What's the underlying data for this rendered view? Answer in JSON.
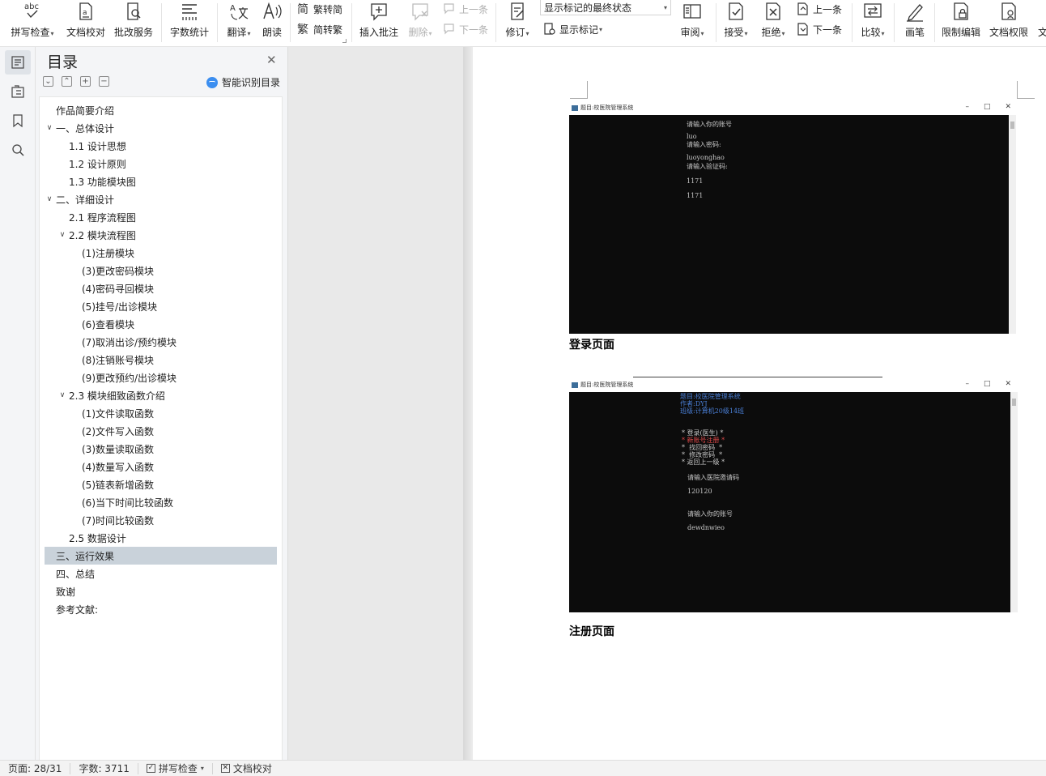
{
  "ribbon": {
    "spell_check": "拼写检查",
    "doc_proof": "文档校对",
    "revision_service": "批改服务",
    "word_count": "字数统计",
    "translate": "翻译",
    "read_aloud": "朗读",
    "trad_to_simp": "繁转简",
    "simp_to_trad": "简转繁",
    "insert_comment": "插入批注",
    "delete": "删除",
    "prev_comment": "上一条",
    "next_comment": "下一条",
    "track_changes": "修订",
    "markup_select": "显示标记的最终状态",
    "show_markup": "显示标记",
    "review": "审阅",
    "accept": "接受",
    "reject": "拒绝",
    "prev_change": "上一条",
    "next_change": "下一条",
    "compare": "比较",
    "pen": "画笔",
    "restrict_edit": "限制编辑",
    "doc_permission": "文档权限",
    "cut_label": "文"
  },
  "toc": {
    "title": "目录",
    "smart_toc": "智能识别目录",
    "items": [
      {
        "label": "作品简要介绍",
        "level": 1,
        "twisty": ""
      },
      {
        "label": "一、总体设计",
        "level": 1,
        "twisty": "∨"
      },
      {
        "label": "1.1 设计思想",
        "level": 2,
        "twisty": ""
      },
      {
        "label": "1.2 设计原则",
        "level": 2,
        "twisty": ""
      },
      {
        "label": "1.3 功能模块图",
        "level": 2,
        "twisty": ""
      },
      {
        "label": "二、详细设计",
        "level": 1,
        "twisty": "∨"
      },
      {
        "label": "2.1 程序流程图",
        "level": 2,
        "twisty": ""
      },
      {
        "label": "2.2 模块流程图",
        "level": 2,
        "twisty": "∨"
      },
      {
        "label": "(1)注册模块",
        "level": 3,
        "twisty": ""
      },
      {
        "label": "(3)更改密码模块",
        "level": 3,
        "twisty": ""
      },
      {
        "label": "(4)密码寻回模块",
        "level": 3,
        "twisty": ""
      },
      {
        "label": "(5)挂号/出诊模块",
        "level": 3,
        "twisty": ""
      },
      {
        "label": "(6)查看模块",
        "level": 3,
        "twisty": ""
      },
      {
        "label": "(7)取消出诊/预约模块",
        "level": 3,
        "twisty": ""
      },
      {
        "label": "(8)注销账号模块",
        "level": 3,
        "twisty": ""
      },
      {
        "label": "(9)更改预约/出诊模块",
        "level": 3,
        "twisty": ""
      },
      {
        "label": "2.3 模块细致函数介绍",
        "level": 2,
        "twisty": "∨"
      },
      {
        "label": "(1)文件读取函数",
        "level": 3,
        "twisty": ""
      },
      {
        "label": "(2)文件写入函数",
        "level": 3,
        "twisty": ""
      },
      {
        "label": "(3)数量读取函数",
        "level": 3,
        "twisty": ""
      },
      {
        "label": "(4)数量写入函数",
        "level": 3,
        "twisty": ""
      },
      {
        "label": "(5)链表新增函数",
        "level": 3,
        "twisty": ""
      },
      {
        "label": "(6)当下时间比较函数",
        "level": 3,
        "twisty": ""
      },
      {
        "label": "(7)时间比较函数",
        "level": 3,
        "twisty": ""
      },
      {
        "label": "2.5 数据设计",
        "level": 2,
        "twisty": ""
      },
      {
        "label": "三、运行效果",
        "level": 1,
        "twisty": "",
        "active": true
      },
      {
        "label": "四、总结",
        "level": 1,
        "twisty": ""
      },
      {
        "label": "致谢",
        "level": 1,
        "twisty": ""
      },
      {
        "label": "参考文献:",
        "level": 1,
        "twisty": ""
      }
    ]
  },
  "document": {
    "window1": {
      "title": "题目:校医院管理系统",
      "lines": [
        {
          "text": "请输入你的账号",
          "color": "gray"
        },
        {
          "text": "luo",
          "color": "gray"
        },
        {
          "text": "请输入密码:",
          "color": "gray"
        },
        {
          "text": "luoyonghao",
          "color": "gray"
        },
        {
          "text": "请输入验证码:",
          "color": "gray"
        },
        {
          "text": "1171",
          "color": "gray"
        },
        {
          "text": "1171",
          "color": "gray"
        }
      ]
    },
    "caption1": "登录页面",
    "window2": {
      "title": "题目:校医院管理系统",
      "lines": [
        {
          "text": "题目:校医院管理系统",
          "color": "blue"
        },
        {
          "text": "作者:DYJ",
          "color": "blue"
        },
        {
          "text": "班级:计算机20级14班",
          "color": "blue"
        },
        {
          "text": "* 登录(医生) *",
          "color": "gray"
        },
        {
          "text": "* 新账号注册 *",
          "color": "red"
        },
        {
          "text": "*  找回密码  *",
          "color": "gray"
        },
        {
          "text": "*  修改密码  *",
          "color": "gray"
        },
        {
          "text": "* 返回上一级 *",
          "color": "gray"
        },
        {
          "text": "请输入医院邀请码",
          "color": "gray"
        },
        {
          "text": "120120",
          "color": "gray"
        },
        {
          "text": "请输入你的账号",
          "color": "gray"
        },
        {
          "text": "dewdnwieo",
          "color": "gray"
        }
      ]
    },
    "caption2": "注册页面"
  },
  "status": {
    "page": "页面: 28/31",
    "word_count": "字数: 3711",
    "spell_check": "拼写检查",
    "doc_proof": "文档校对"
  }
}
